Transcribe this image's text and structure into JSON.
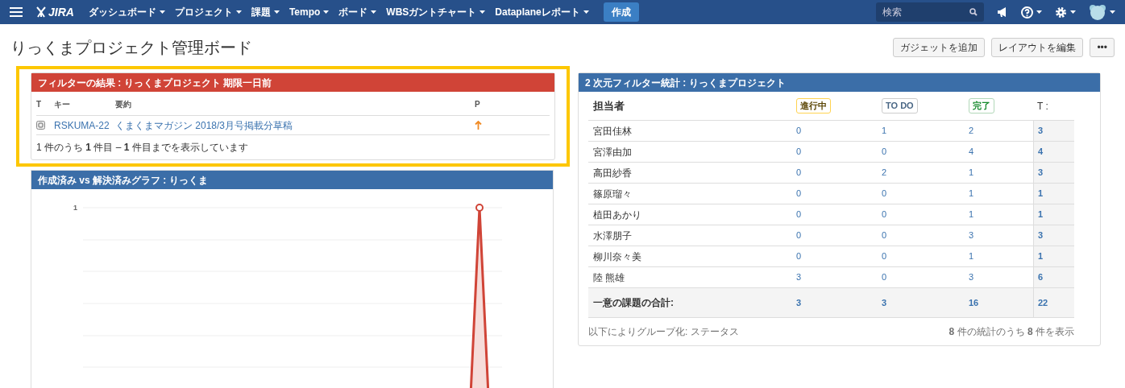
{
  "nav": {
    "logo": "JIRA",
    "menus": [
      {
        "label": "ダッシュボード",
        "dropdown": true
      },
      {
        "label": "プロジェクト",
        "dropdown": true
      },
      {
        "label": "課題",
        "dropdown": true
      },
      {
        "label": "Tempo",
        "dropdown": true
      },
      {
        "label": "ボード",
        "dropdown": true
      },
      {
        "label": "WBSガントチャート",
        "dropdown": true
      },
      {
        "label": "Dataplaneレポート",
        "dropdown": true
      }
    ],
    "create": "作成",
    "search": {
      "placeholder": "検索"
    }
  },
  "page": {
    "title": "りっくまプロジェクト管理ボード",
    "buttons": [
      "ガジェットを追加",
      "レイアウトを編集",
      "•••"
    ]
  },
  "filter_gadget": {
    "title": "フィルターの結果 : りっくまプロジェクト 期限一日前",
    "highlighted": true,
    "columns": [
      "T",
      "キー",
      "要約",
      "P"
    ],
    "rows": [
      {
        "key": "RSKUMA-22",
        "summary": "くまくまマガジン 2018/3月号掲載分草稿"
      }
    ],
    "footer": "1 件のうち **1** 件目 – **1** 件目までを表示しています"
  },
  "chart_gadget": {
    "title": "作成済み vs 解決済みグラフ : りっくま",
    "tick_label": "1"
  },
  "stats_gadget": {
    "title": "2 次元フィルター統計 : りっくまプロジェクト",
    "columns": [
      {
        "label": "担当者",
        "kind": "plain"
      },
      {
        "label": "進行中",
        "kind": "inprogress"
      },
      {
        "label": "TO DO",
        "kind": "todo"
      },
      {
        "label": "完了",
        "kind": "done"
      },
      {
        "label": "T :",
        "kind": "plain"
      }
    ],
    "rows": [
      {
        "name": "宮田佳林",
        "values": [
          "0",
          "1",
          "2"
        ],
        "total": "3"
      },
      {
        "name": "宮澤由加",
        "values": [
          "0",
          "0",
          "4"
        ],
        "total": "4"
      },
      {
        "name": "高田紗香",
        "values": [
          "0",
          "2",
          "1"
        ],
        "total": "3"
      },
      {
        "name": "篠原瑠々",
        "values": [
          "0",
          "0",
          "1"
        ],
        "total": "1"
      },
      {
        "name": "植田あかり",
        "values": [
          "0",
          "0",
          "1"
        ],
        "total": "1"
      },
      {
        "name": "水澤朋子",
        "values": [
          "0",
          "0",
          "3"
        ],
        "total": "3"
      },
      {
        "name": "柳川奈々美",
        "values": [
          "0",
          "0",
          "1"
        ],
        "total": "1"
      },
      {
        "name": "陸 熊雄",
        "values": [
          "3",
          "0",
          "3"
        ],
        "total": "6"
      }
    ],
    "totals": {
      "label": "一意の課題の合計:",
      "values": [
        "3",
        "3",
        "16"
      ],
      "total": "22"
    },
    "grouped_by": "以下によりグループ化: ステータス",
    "summary": "**8** 件の統計のうち **8** 件を表示"
  }
}
